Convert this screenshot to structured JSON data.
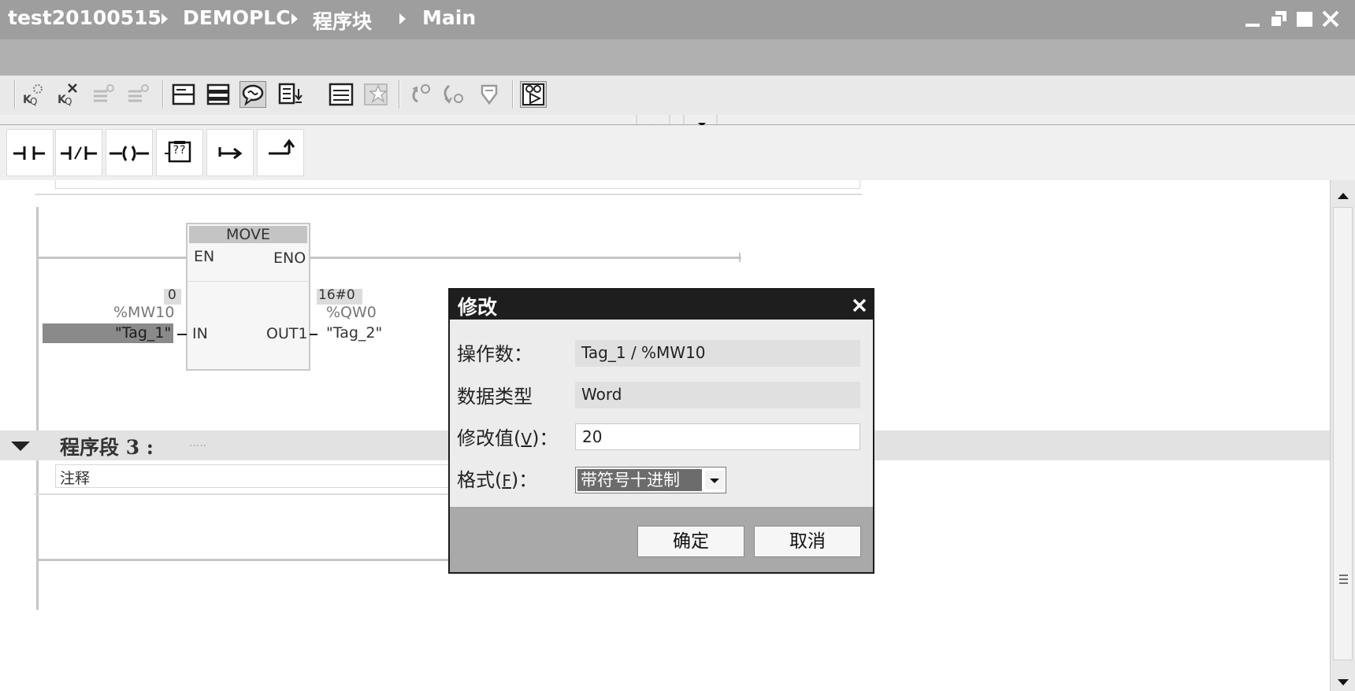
{
  "breadcrumb": {
    "project": "test20100515",
    "device": "DEMOPLC",
    "folder": "程序块",
    "block": "Main"
  },
  "favorites": {
    "no_contact": "┤├",
    "nc_contact": "┤/├",
    "coil": "─()─",
    "empty_box": "??",
    "open_branch": "↦",
    "close_branch": "↵"
  },
  "editor": {
    "move_block": {
      "title": "MOVE",
      "en": "EN",
      "eno": "ENO",
      "in": "IN",
      "out1": "OUT1"
    },
    "in_operand": {
      "monitor_value": "0",
      "address": "%MW10",
      "tag": "\"Tag_1\""
    },
    "out_operand": {
      "monitor_value": "16#0",
      "address": "%QW0",
      "tag": "\"Tag_2\""
    },
    "network3": {
      "title": "程序段 3 :",
      "dots": ".....",
      "comment": "注释"
    }
  },
  "dialog": {
    "title": "修改",
    "operand_label": "操作数：",
    "operand_value": "Tag_1 / %MW10",
    "datatype_label": "数据类型",
    "datatype_value": "Word",
    "modify_label_pre": "修改值(",
    "modify_label_key": "V",
    "modify_label_post": ")：",
    "modify_value": "20",
    "format_label_pre": "格式(",
    "format_label_key": "F",
    "format_label_post": ")：",
    "format_value": "带符号十进制",
    "ok_label": "确定",
    "cancel_label": "取消"
  }
}
